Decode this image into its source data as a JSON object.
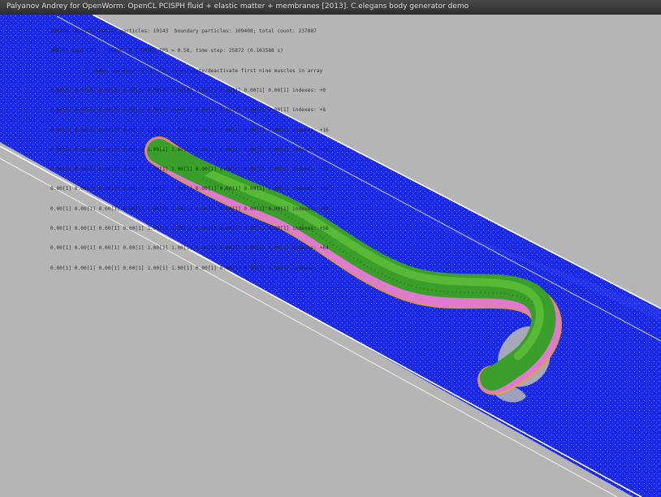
{
  "window": {
    "title": "Palyanov Andrey for OpenWorm: OpenCL PCISPH fluid + elastic matter + membranes [2013]. C.elegans body generator demo"
  },
  "overlay": {
    "lines": [
      "180336  elastic matter particles: 10143  boundary particles: 109408; total count: 237887",
      "aMD(R) Quad CPU    Q8300  @ 2.50GHz FPS = 0.58, time step: 25872 (0.103588 s)",
      "           // cemor use keys '1' to '9' to activate/deactivate first nine muscles in array",
      "0.00[0] 0.00[0] 0.00[1] 0.00[1] 0.00[0] 0.00[0] 0.00[1] 0.00[1] 0.00[1] 0.00[1] indexes: +0",
      "0.00[0] 0.00[1] 0.00[2] 0.00[1] 0.00[2] 0.00[1] 0.00[2] 0.00[2] 0.00[2] 0.00[1] indexes: +8",
      "0.00[1] 0.00[1] 0.00[1] 0.00[1] 1.00[1] 1.00[1] 0.00[1] 0.00[1] 0.00[1] 0.00[1] indexes: +16",
      "0.00[1] 0.00[1] 0.00[1] 0.00[1] 1.00[1] 1.00[1] 0.00[1] 0.00[1] 0.00[1] 0.00[1] indexes: +24",
      "0.00[1] 0.00[1] 0.00[1] 0.00[1] 1.00[1] 1.00[1] 0.00[1] 0.00[1] 0.00[1] 0.00[1] indexes: +32",
      "0.00[1] 0.00[1] 0.00[1] 0.00[1] 1.00[1] 1.00[1] 0.00[1] 0.00[1] 0.00[1] 0.00[1] indexes: +40",
      "0.00[1] 0.00[1] 0.00[1] 0.00[1] 1.00[1] 1.00[1] 0.00[1] 0.00[1] 0.00[1] 0.00[1] indexes: +48",
      "0.00[1] 0.00[1] 0.00[1] 0.00[1] 1.00[1] 1.00[1] 0.00[1] 0.00[1] 0.00[1] 0.00[1] indexes: +56",
      "0.00[1] 0.00[1] 0.00[1] 0.00[1] 1.00[1] 1.00[1] 0.00[1] 0.00[1] 0.00[1] 0.00[1] indexes: +64",
      "0.00[1] 0.00[1] 0.00[1] 0.00[1] 1.00[1] 1.00[1] 0.00[1] 0.00[1] 0.00[1] 0.00[1] indexes: +72"
    ]
  },
  "colors": {
    "background": "#b5b5b5",
    "fluid": "#1a28e8",
    "boundary": "#ffffff",
    "worm_body": "#3a9e2a",
    "membrane_pink": "#e07ad0",
    "membrane_orange": "#f0a030"
  }
}
